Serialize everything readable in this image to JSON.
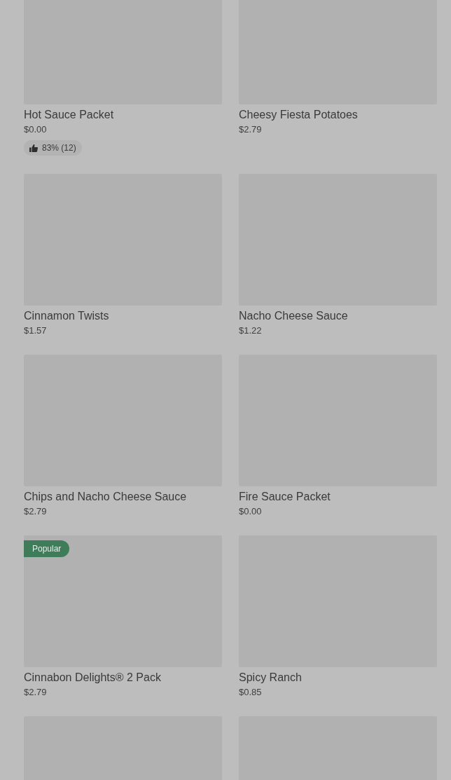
{
  "items": [
    {
      "name": "Hot Sauce Packet",
      "price": "$0.00",
      "rating": "83% (12)"
    },
    {
      "name": "Cheesy Fiesta Potatoes",
      "price": "$2.79"
    },
    {
      "name": "Cinnamon Twists",
      "price": "$1.57"
    },
    {
      "name": "Nacho Cheese Sauce",
      "price": "$1.22"
    },
    {
      "name": "Chips and Nacho Cheese Sauce",
      "price": "$2.79"
    },
    {
      "name": "Fire Sauce Packet",
      "price": "$0.00"
    },
    {
      "name": "Cinnabon Delights® 2 Pack",
      "price": "$2.79",
      "badge": "Popular"
    },
    {
      "name": "Spicy Ranch",
      "price": "$0.85"
    }
  ]
}
